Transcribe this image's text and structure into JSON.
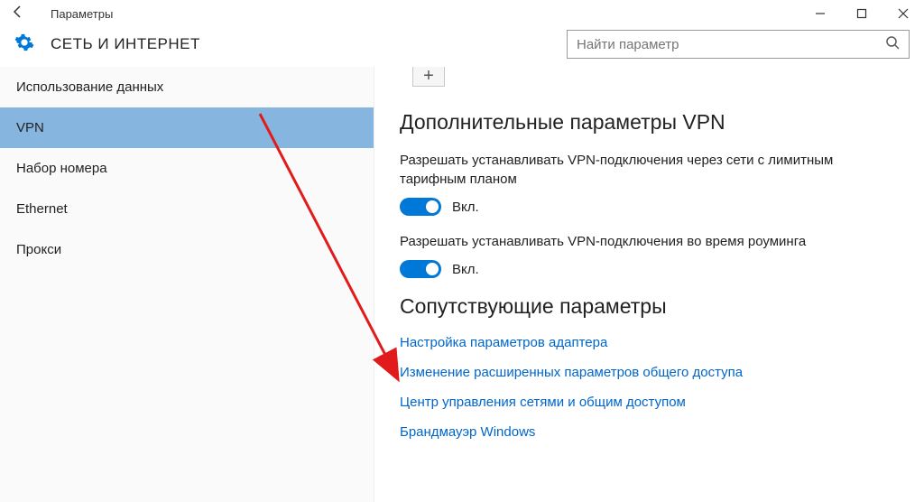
{
  "window": {
    "title": "Параметры"
  },
  "header": {
    "section_title": "СЕТЬ И ИНТЕРНЕТ",
    "search_placeholder": "Найти параметр"
  },
  "sidebar": {
    "items": [
      {
        "label": "Использование данных"
      },
      {
        "label": "VPN"
      },
      {
        "label": "Набор номера"
      },
      {
        "label": "Ethernet"
      },
      {
        "label": "Прокси"
      }
    ],
    "selected_index": 1
  },
  "content": {
    "add_symbol": "+",
    "advanced_heading": "Дополнительные параметры VPN",
    "setting1": {
      "label": "Разрешать устанавливать VPN-подключения через сети с лимитным тарифным планом",
      "state": "Вкл."
    },
    "setting2": {
      "label": "Разрешать устанавливать VPN-подключения во время роуминга",
      "state": "Вкл."
    },
    "related_heading": "Сопутствующие параметры",
    "links": [
      "Настройка параметров адаптера",
      "Изменение расширенных параметров общего доступа",
      "Центр управления сетями и общим доступом",
      "Брандмауэр Windows"
    ]
  },
  "annotation": {
    "arrow_color": "#e11b1b"
  }
}
